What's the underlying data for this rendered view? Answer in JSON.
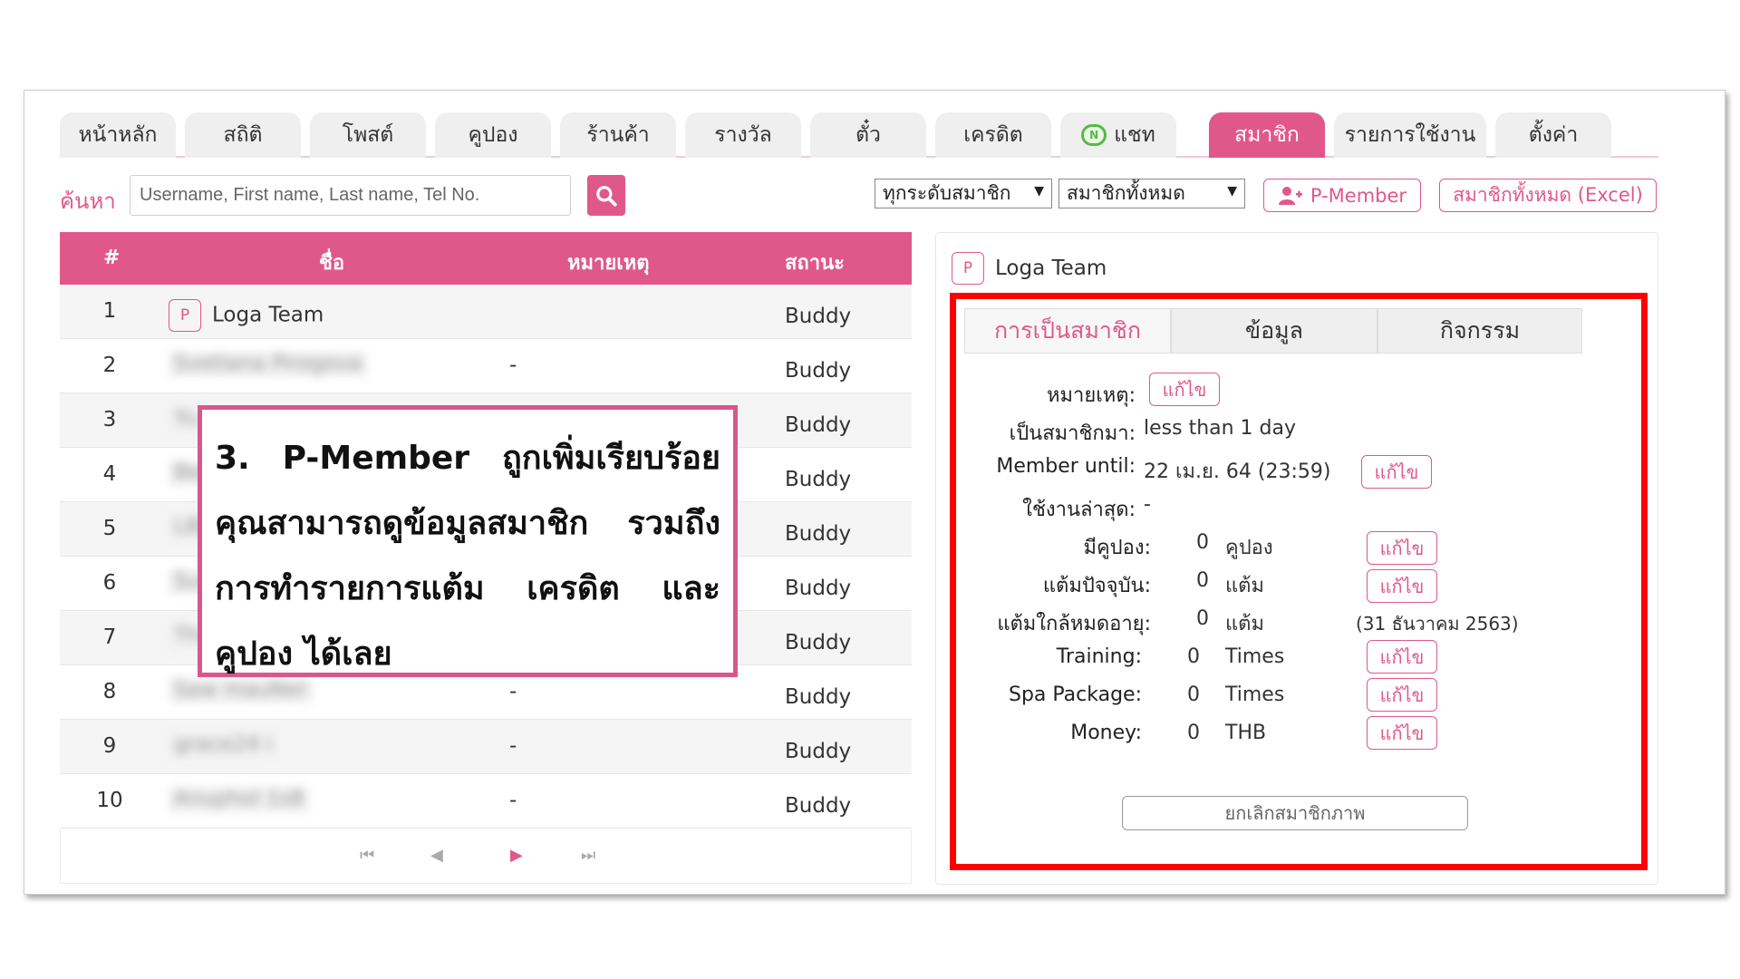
{
  "tabs": [
    {
      "label": "หน้าหลัก"
    },
    {
      "label": "สถิติ"
    },
    {
      "label": "โพสต์"
    },
    {
      "label": "คูปอง"
    },
    {
      "label": "ร้านค้า"
    },
    {
      "label": "รางวัล"
    },
    {
      "label": "ตั๋ว"
    },
    {
      "label": "เครดิต"
    },
    {
      "label": "แชท",
      "icon": "chat-icon"
    },
    {
      "label": "สมาชิก",
      "active": true
    },
    {
      "label": "รายการใช้งาน"
    },
    {
      "label": "ตั้งค่า"
    }
  ],
  "search": {
    "label": "ค้นหา",
    "placeholder": "Username, First name, Last name, Tel No.",
    "filter_level": "ทุกระดับสมาชิก",
    "filter_members": "สมาชิกทั้งหมด",
    "pmember_button": "P-Member",
    "excel_button": "สมาชิกทั้งหมด (Excel)"
  },
  "table": {
    "headers": {
      "num": "#",
      "name": "ชื่อ",
      "note": "หมายเหตุ",
      "status": "สถานะ"
    },
    "rows": [
      {
        "num": "1",
        "badge": "P",
        "name": "Loga Team",
        "note": "",
        "status": "Buddy"
      },
      {
        "num": "2",
        "name": "Svetlana Pirogova",
        "note": "-",
        "status": "Buddy"
      },
      {
        "num": "3",
        "name": "Yu",
        "note": "",
        "status": "Buddy"
      },
      {
        "num": "4",
        "name": "Ben",
        "note": "",
        "status": "Buddy"
      },
      {
        "num": "5",
        "name": "LBI",
        "note": "",
        "status": "Buddy"
      },
      {
        "num": "6",
        "name": "Sui",
        "note": "",
        "status": "Buddy"
      },
      {
        "num": "7",
        "name": "The",
        "note": "",
        "status": "Buddy"
      },
      {
        "num": "8",
        "name": "Saw mauNer",
        "note": "-",
        "status": "Buddy"
      },
      {
        "num": "9",
        "name": "grace24 i",
        "note": "-",
        "status": "Buddy"
      },
      {
        "num": "10",
        "name": "Anuphol 1s8",
        "note": "-",
        "status": "Buddy"
      }
    ]
  },
  "panel": {
    "badge": "P",
    "title": "Loga Team",
    "subtabs": [
      {
        "label": "การเป็นสมาชิก",
        "active": true
      },
      {
        "label": "ข้อมูล"
      },
      {
        "label": "กิจกรรม"
      }
    ],
    "note_label": "หมายเหตุ:",
    "member_since_label": "เป็นสมาชิกมา:",
    "member_since_value": "less  than  1  day",
    "member_until_label": "Member  until:",
    "member_until_value": "22  เม.ย.  64  (23:59)",
    "last_used_label": "ใช้งานล่าสุด:",
    "last_used_value": "-",
    "coupon_label": "มีคูปอง:",
    "coupon_count": "0",
    "coupon_unit": "คูปอง",
    "points_label": "แต้มปัจจุบัน:",
    "points_count": "0",
    "points_unit": "แต้ม",
    "expiring_label": "แต้มใกล้หมดอายุ:",
    "expiring_count": "0",
    "expiring_unit": "แต้ม",
    "expiring_date": "(31  ธันวาคม  2563)",
    "training_label": "Training:",
    "training_count": "0",
    "training_unit": "Times",
    "spa_label": "Spa  Package:",
    "spa_count": "0",
    "spa_unit": "Times",
    "money_label": "Money:",
    "money_count": "0",
    "money_unit": "THB",
    "edit_label": "แก้ไข",
    "cancel_label": "ยกเลิกสมาชิกภาพ"
  },
  "callout": {
    "text": "3.  P-Member  ถูกเพิ่มเรียบร้อย คุณสามารถดูข้อมูลสมาชิก รวมถึงการทำรายการแต้ม เครดิต และคูปอง ได้เลย"
  },
  "colors": {
    "accent": "#e0588a",
    "highlight": "#ff0000"
  }
}
